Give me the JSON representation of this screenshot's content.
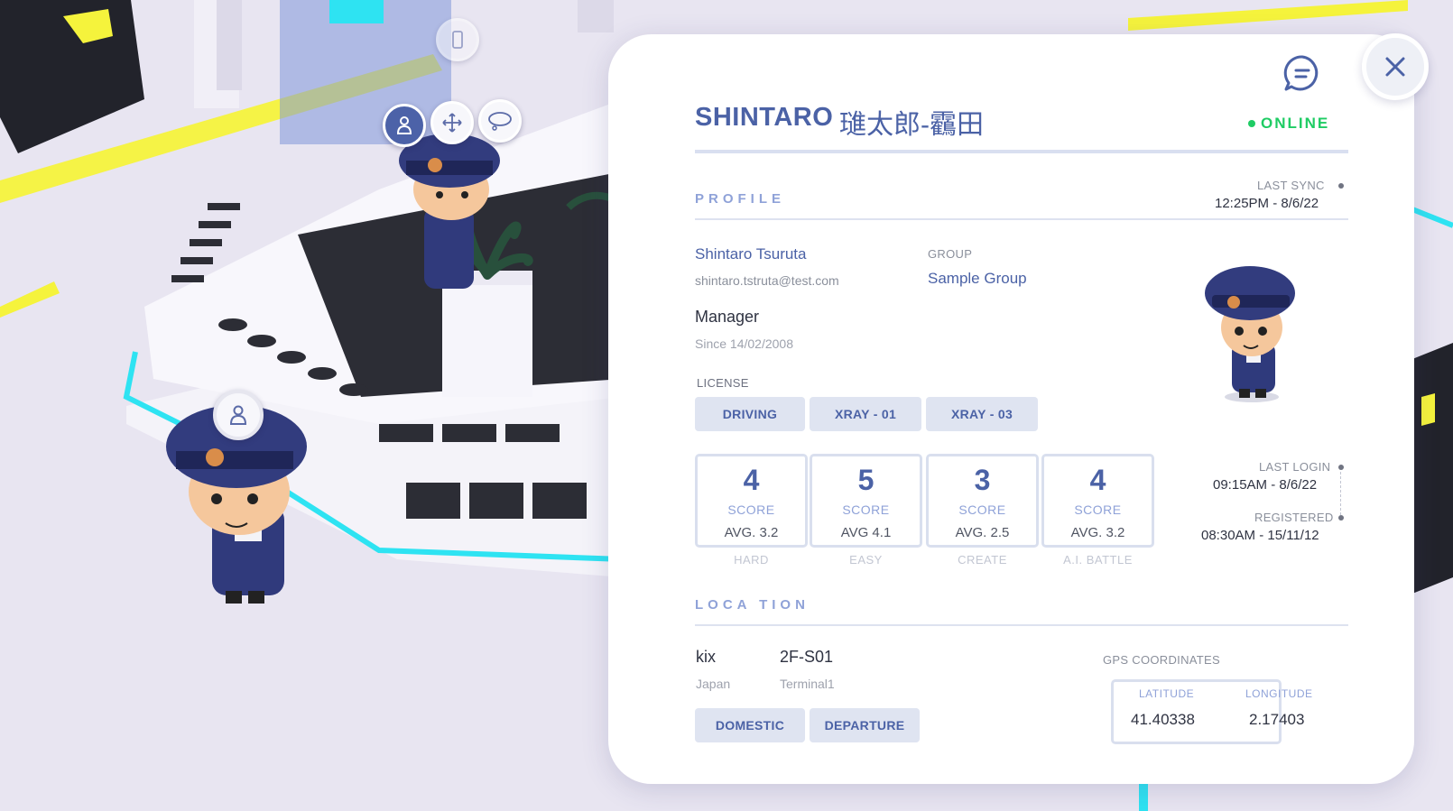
{
  "window": {
    "chat_icon": "chat-bubble-icon",
    "close_icon": "close-icon"
  },
  "scene_pins": {
    "icons": [
      "person-icon",
      "move-arrows-icon",
      "thought-bubble-icon",
      "person-icon",
      "phone-icon"
    ]
  },
  "header": {
    "name": "SHINTARO",
    "kanji_name": "璡太郎-靏田",
    "status": "ONLINE",
    "status_color": "#1fcc64"
  },
  "profile": {
    "section_title": "PROFILE",
    "last_sync_label": "LAST SYNC",
    "last_sync": "12:25PM - 8/6/22",
    "full_name": "Shintaro Tsuruta",
    "email": "shintaro.tstruta@test.com",
    "group_label": "GROUP",
    "group": "Sample Group",
    "role": "Manager",
    "since": "Since 14/02/2008",
    "license_label": "LICENSE",
    "licenses": [
      "DRIVING",
      "XRAY - 01",
      "XRAY - 03"
    ]
  },
  "scores": [
    {
      "value": "4",
      "label": "SCORE",
      "avg": "AVG. 3.2",
      "category": "HARD"
    },
    {
      "value": "5",
      "label": "SCORE",
      "avg": "AVG  4.1",
      "category": "EASY"
    },
    {
      "value": "3",
      "label": "SCORE",
      "avg": "AVG. 2.5",
      "category": "CREATE"
    },
    {
      "value": "4",
      "label": "SCORE",
      "avg": "AVG. 3.2",
      "category": "A.I. BATTLE"
    }
  ],
  "activity": {
    "last_login_label": "LAST LOGIN",
    "last_login": "09:15AM - 8/6/22",
    "registered_label": "REGISTERED",
    "registered": "08:30AM - 15/11/12"
  },
  "location": {
    "section_title": "LOCA TION",
    "site": "kix",
    "country": "Japan",
    "zone": "2F-S01",
    "terminal": "Terminal1",
    "tags": [
      "DOMESTIC",
      "DEPARTURE"
    ],
    "gps_label": "GPS  COORDINATES",
    "latitude_label": "LATITUDE",
    "latitude": "41.40338",
    "longitude_label": "LONGITUDE",
    "longitude": "2.17403"
  },
  "colors": {
    "accent": "#4b62a6",
    "accent_light": "#8fa2d8",
    "tag_bg": "#dfe4f1",
    "cyan": "#2ee3f2",
    "yellow": "#f4ef3c"
  }
}
